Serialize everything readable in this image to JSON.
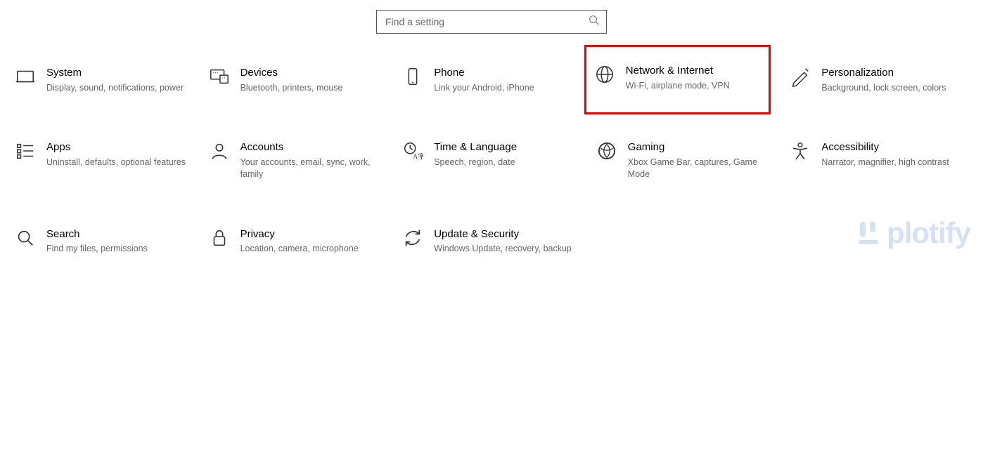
{
  "search": {
    "placeholder": "Find a setting"
  },
  "tiles": [
    {
      "id": "system",
      "title": "System",
      "desc": "Display, sound, notifications, power"
    },
    {
      "id": "devices",
      "title": "Devices",
      "desc": "Bluetooth, printers, mouse"
    },
    {
      "id": "phone",
      "title": "Phone",
      "desc": "Link your Android, iPhone"
    },
    {
      "id": "network",
      "title": "Network & Internet",
      "desc": "Wi-Fi, airplane mode, VPN",
      "highlight": true
    },
    {
      "id": "personalization",
      "title": "Personalization",
      "desc": "Background, lock screen, colors"
    },
    {
      "id": "apps",
      "title": "Apps",
      "desc": "Uninstall, defaults, optional features"
    },
    {
      "id": "accounts",
      "title": "Accounts",
      "desc": "Your accounts, email, sync, work, family"
    },
    {
      "id": "time-language",
      "title": "Time & Language",
      "desc": "Speech, region, date"
    },
    {
      "id": "gaming",
      "title": "Gaming",
      "desc": "Xbox Game Bar, captures, Game Mode"
    },
    {
      "id": "accessibility",
      "title": "Accessibility",
      "desc": "Narrator, magnifier, high contrast"
    },
    {
      "id": "search",
      "title": "Search",
      "desc": "Find my files, permissions"
    },
    {
      "id": "privacy",
      "title": "Privacy",
      "desc": "Location, camera, microphone"
    },
    {
      "id": "update-security",
      "title": "Update & Security",
      "desc": "Windows Update, recovery, backup"
    }
  ],
  "watermark": "plotify"
}
